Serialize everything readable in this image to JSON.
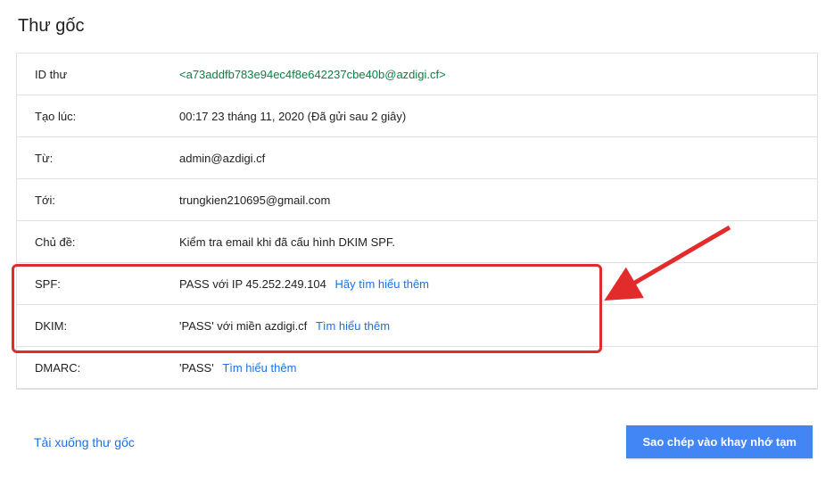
{
  "title": "Thư gốc",
  "rows": {
    "id_label": "ID thư",
    "id_value": "<a73addfb783e94ec4f8e642237cbe40b@azdigi.cf>",
    "created_label": "Tạo lúc:",
    "created_value": "00:17 23 tháng 11, 2020 (Đã gửi sau 2 giây)",
    "from_label": "Từ:",
    "from_value": "admin@azdigi.cf",
    "to_label": "Tới:",
    "to_value": "trungkien210695@gmail.com",
    "subject_label": "Chủ đề:",
    "subject_value": "Kiểm tra email khi đã cấu hình DKIM SPF.",
    "spf_label": "SPF:",
    "spf_value": "PASS với IP 45.252.249.104",
    "spf_link": "Hãy tìm hiểu thêm",
    "dkim_label": "DKIM:",
    "dkim_value": "'PASS' với miền azdigi.cf",
    "dkim_link": "Tìm hiểu thêm",
    "dmarc_label": "DMARC:",
    "dmarc_value": "'PASS'",
    "dmarc_link": "Tìm hiểu thêm"
  },
  "footer": {
    "download_label": "Tải xuống thư gốc",
    "copy_label": "Sao chép vào khay nhớ tạm"
  },
  "annotation": {
    "highlight_color": "#e22b2b",
    "arrow_color": "#e22b2b"
  }
}
